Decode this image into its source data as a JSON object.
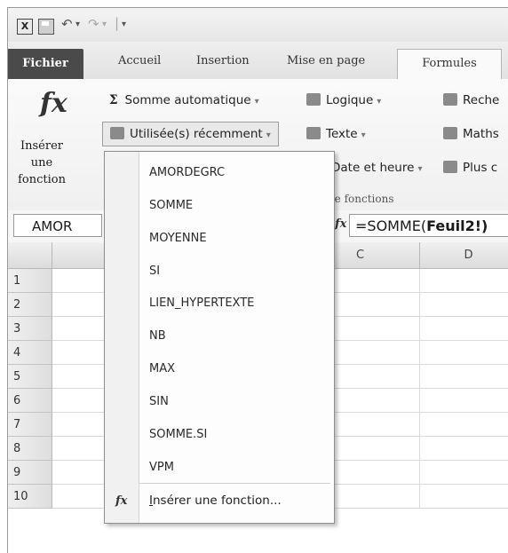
{
  "quick_access": {
    "excel_icon": "excel-icon",
    "undo_glyph": "↶",
    "redo_glyph": "↷",
    "customize_glyph": "▾"
  },
  "tabs": [
    "Fichier",
    "Accueil",
    "Insertion",
    "Mise en page",
    "Formules"
  ],
  "active_tab": "Formules",
  "ribbon": {
    "insert_function_symbol": "fx",
    "insert_function_label_1": "Insérer une",
    "insert_function_label_2": "fonction",
    "autosum": "Somme automatique",
    "autosum_symbol": "Σ",
    "recent": "Utilisée(s) récemment",
    "logical": "Logique",
    "text": "Texte",
    "datetime": "Date et heure",
    "lookup": "Reche",
    "math": "Maths",
    "more": "Plus c",
    "group_label": "de fonctions"
  },
  "formula_bar": {
    "name_box": "AMOR",
    "fx": "fx",
    "formula_prefix": "=SOMME(",
    "formula_bold": "Feuil2!)"
  },
  "columns": [
    "C",
    "D"
  ],
  "rows": [
    "1",
    "2",
    "3",
    "4",
    "5",
    "6",
    "7",
    "8",
    "9",
    "10"
  ],
  "dropdown": {
    "items": [
      "AMORDEGRC",
      "SOMME",
      "MOYENNE",
      "SI",
      "LIEN_HYPERTEXTE",
      "NB",
      "MAX",
      "SIN",
      "SOMME.SI",
      "VPM"
    ],
    "insert_symbol": "fx",
    "insert_label_underlined": "I",
    "insert_label_rest": "nsérer une fonction..."
  }
}
